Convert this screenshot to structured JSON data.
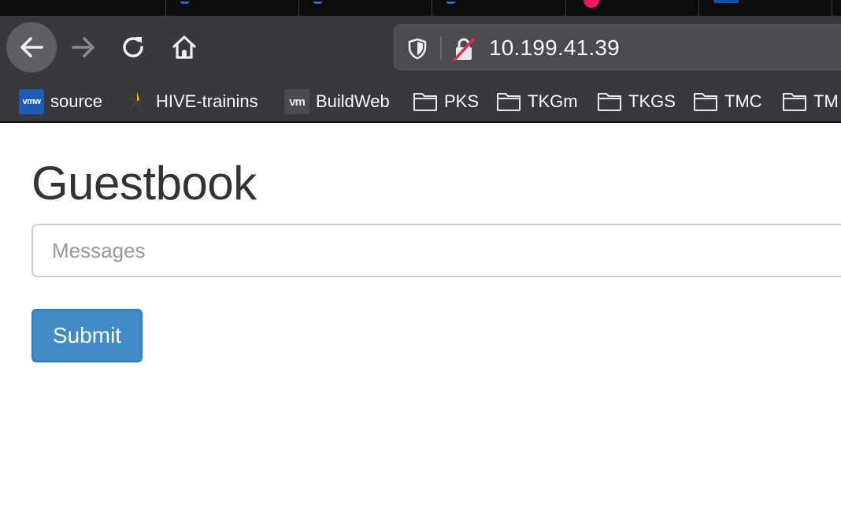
{
  "browser": {
    "url": "10.199.41.39",
    "tabs": [
      {
        "icon": "confluence-icon"
      },
      {
        "icon": "confluence-icon"
      },
      {
        "icon": "confluence-icon"
      },
      {
        "icon": "pink-circle-icon"
      },
      {
        "icon": "blue-square-icon"
      }
    ],
    "nav_icons": [
      "back-arrow-icon",
      "forward-arrow-icon",
      "reload-icon",
      "home-icon"
    ],
    "bookmarks": [
      {
        "label": "source",
        "icon": "vmw-icon",
        "icon_text": "vmw"
      },
      {
        "label": "HIVE-trainins",
        "icon": "hive-logo-icon"
      },
      {
        "label": "BuildWeb",
        "icon": "vm-icon",
        "icon_text": "vm"
      },
      {
        "label": "PKS",
        "icon": "folder-icon"
      },
      {
        "label": "TKGm",
        "icon": "folder-icon"
      },
      {
        "label": "TKGS",
        "icon": "folder-icon"
      },
      {
        "label": "TMC",
        "icon": "folder-icon"
      },
      {
        "label": "TM",
        "icon": "folder-icon"
      }
    ]
  },
  "page": {
    "title": "Guestbook",
    "message_input": {
      "placeholder": "Messages",
      "value": ""
    },
    "submit_label": "Submit"
  },
  "colors": {
    "chrome_dark": "#38383d",
    "tabstrip": "#0c0c0d",
    "button_primary": "#428bca",
    "title_text": "#333333"
  }
}
